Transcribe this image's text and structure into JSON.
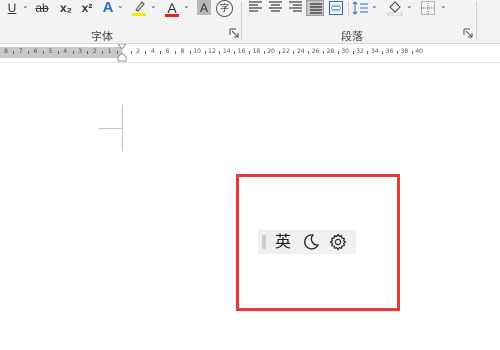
{
  "ribbon": {
    "font_group": {
      "label": "字体",
      "buttons": [
        {
          "name": "underline",
          "text": "U"
        },
        {
          "name": "strikethrough",
          "text": "ab"
        },
        {
          "name": "subscript",
          "text": "x₂"
        },
        {
          "name": "superscript",
          "text": "x²"
        },
        {
          "name": "text-effects",
          "text": "A"
        },
        {
          "name": "highlight-color",
          "text": ""
        },
        {
          "name": "font-color",
          "text": "A"
        },
        {
          "name": "character-shading",
          "text": "A"
        },
        {
          "name": "enclose-characters",
          "text": "字"
        }
      ],
      "colors": {
        "highlight": "#ffe600",
        "font": "#d9251c",
        "effects": "#2b6cc4"
      }
    },
    "paragraph_group": {
      "label": "段落",
      "buttons": [
        "align-left",
        "align-center",
        "align-right",
        "justify",
        "distributed",
        "line-spacing",
        "shading",
        "borders"
      ]
    }
  },
  "ruler": {
    "left_numbers": [
      "8",
      "7",
      "6",
      "5",
      "4",
      "3",
      "2",
      "1"
    ],
    "right_numbers": [
      "2",
      "4",
      "6",
      "8",
      "10",
      "12",
      "14",
      "16",
      "18",
      "20",
      "22",
      "24",
      "26",
      "28",
      "30",
      "32",
      "34",
      "36",
      "38",
      "40"
    ]
  },
  "ime_toolbar": {
    "language": "英",
    "mode_icon": "moon-icon",
    "settings_icon": "gear-icon"
  },
  "colors": {
    "annotation_box": "#e23c3c",
    "ime_background": "#f0f0f0",
    "ribbon_background": "#f3f3f3"
  }
}
